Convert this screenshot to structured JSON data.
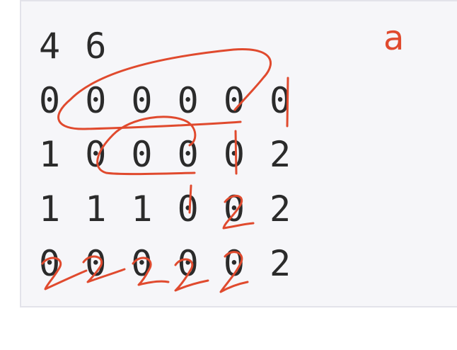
{
  "code": {
    "lines": [
      "4 6",
      "0 0 0 0 0 0",
      "1 0 0 0 0 2",
      "1 1 1 0 0 2",
      "0 0 0 0 0 2"
    ]
  },
  "annotations": {
    "label": "a",
    "ink_color": "#e04a2e"
  }
}
